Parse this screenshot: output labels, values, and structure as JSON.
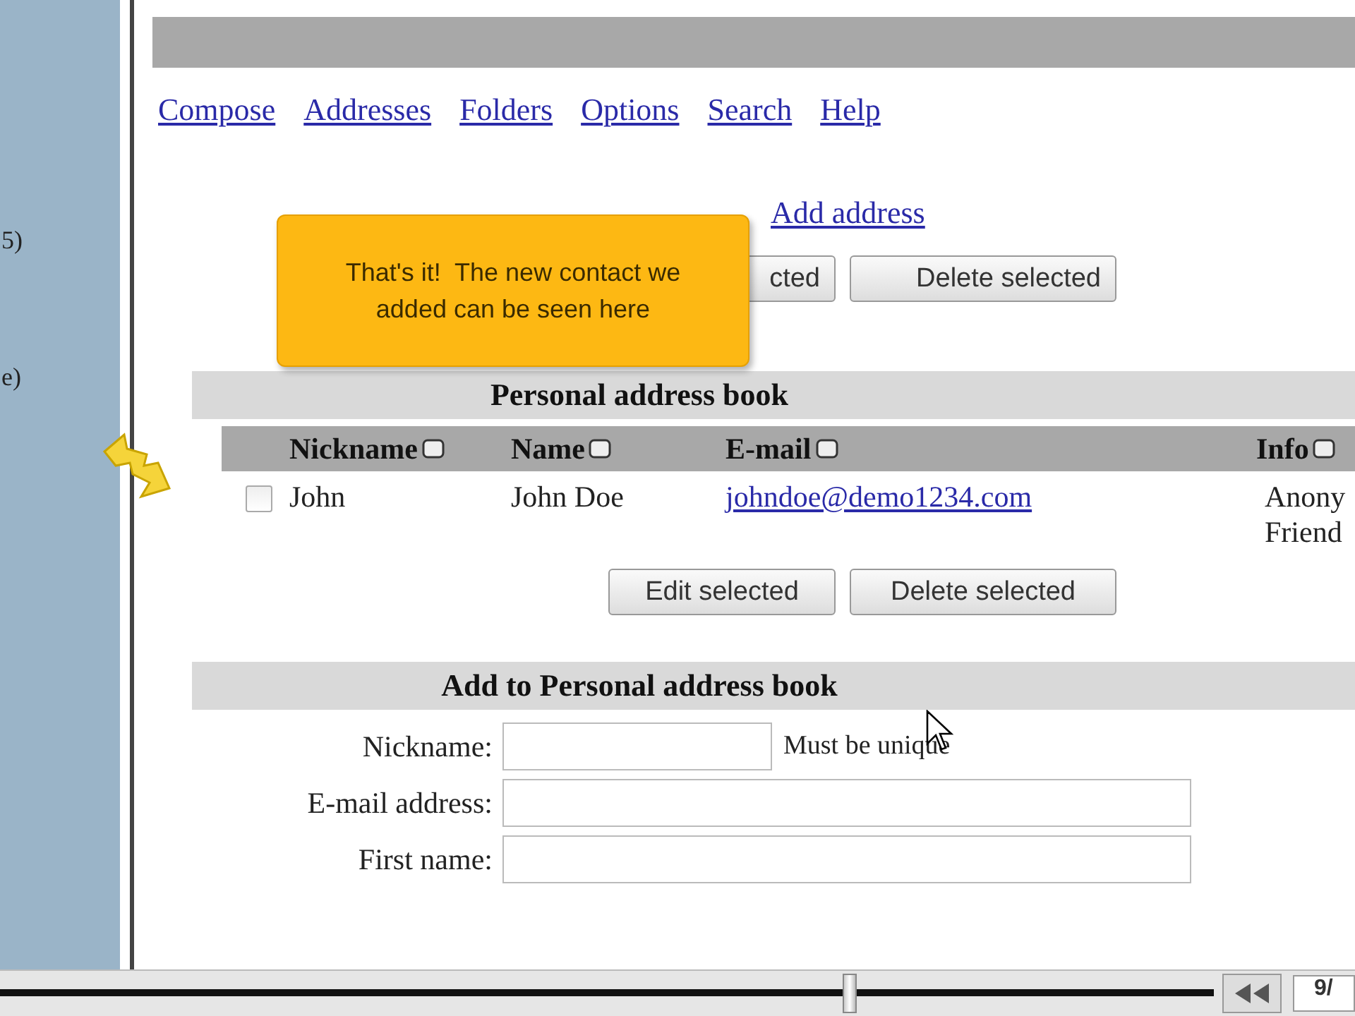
{
  "sidebar": {
    "fragments": [
      "5)",
      "e)"
    ]
  },
  "nav_links": [
    "Compose",
    "Addresses",
    "Folders",
    "Options",
    "Search",
    "Help"
  ],
  "tooltip": {
    "lines": [
      "That's it!  The new contact we",
      "added can be seen here"
    ]
  },
  "top_actions": {
    "link": "Add address",
    "buttons": [
      "cted",
      "Delete selected"
    ]
  },
  "address_book": {
    "title": "Personal address book",
    "columns": [
      "Nickname",
      "Name",
      "E-mail",
      "Info"
    ],
    "rows": [
      {
        "checked": false,
        "nickname": "John",
        "name": "John Doe",
        "email": "johndoe@demo1234.com",
        "info": [
          "Anony",
          "Friend"
        ]
      }
    ],
    "buttons": [
      "Edit selected",
      "Delete selected"
    ]
  },
  "add_form": {
    "title": "Add to Personal address book",
    "fields": [
      {
        "label": "Nickname:",
        "short": true,
        "hint": "Must be unique"
      },
      {
        "label": "E-mail address:",
        "short": false
      },
      {
        "label": "First name:",
        "short": false
      }
    ]
  },
  "player": {
    "level": 0.7,
    "counter": "9/"
  }
}
